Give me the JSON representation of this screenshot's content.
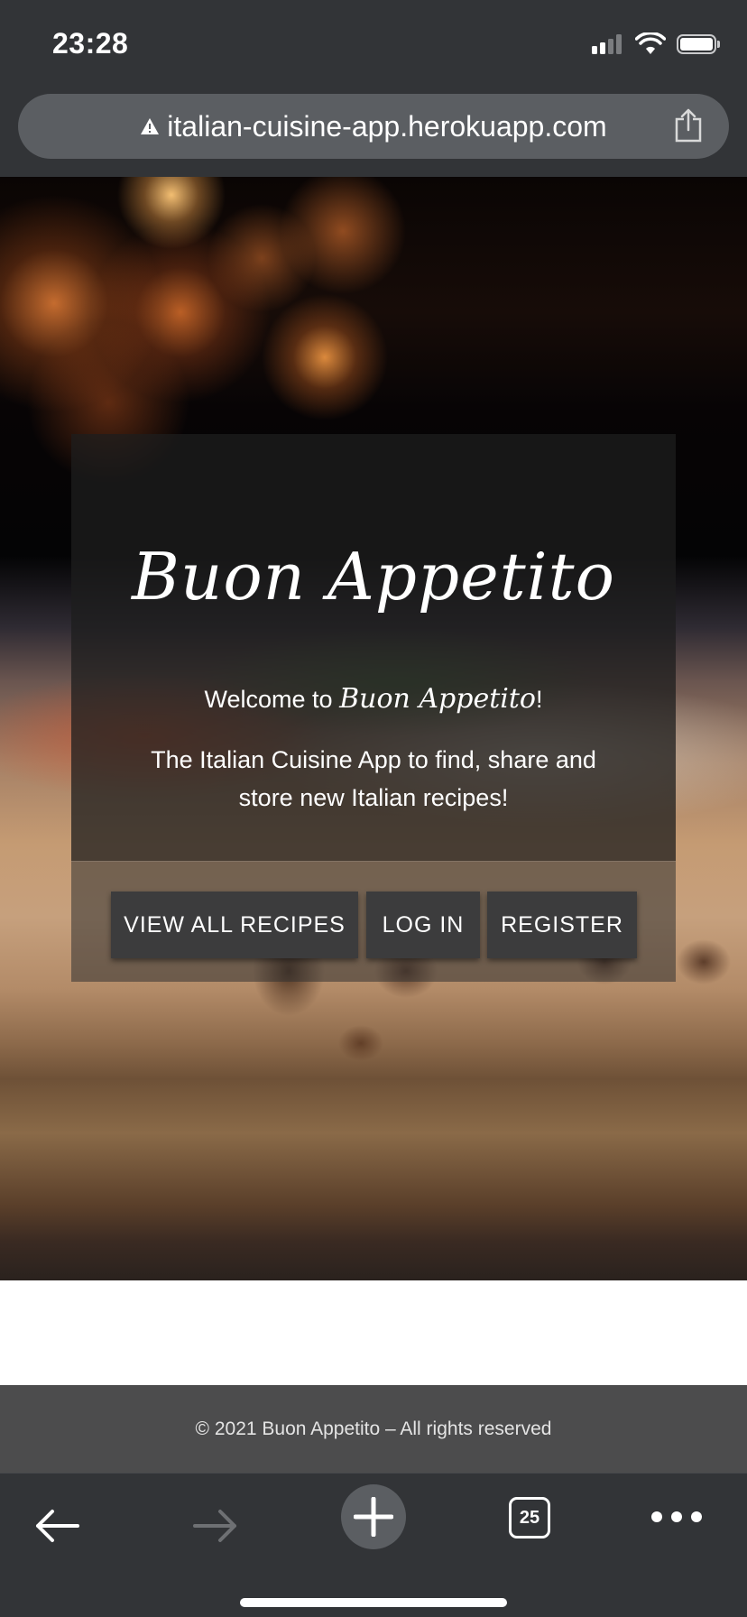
{
  "status_bar": {
    "time": "23:28",
    "icons": [
      "cellular-signal-icon",
      "wifi-icon",
      "battery-icon"
    ]
  },
  "browser": {
    "url": "italian-cuisine-app.herokuapp.com",
    "icons": [
      "warning-icon",
      "share-icon"
    ],
    "toolbar": {
      "tab_count": "25",
      "icons": [
        "back-arrow-icon",
        "forward-arrow-icon",
        "plus-icon",
        "tabs-icon",
        "more-dots-icon"
      ]
    }
  },
  "hero": {
    "title": "Buon Appetito",
    "welcome_prefix": "Welcome to ",
    "welcome_brand": "Buon Appetito",
    "welcome_suffix": "!",
    "description": "The Italian Cuisine App to find, share and store new Italian recipes!",
    "buttons": {
      "view_recipes": "VIEW ALL RECIPES",
      "login": "LOG IN",
      "register": "REGISTER"
    }
  },
  "footer": {
    "text": "© 2021 Buon Appetito – All rights reserved"
  },
  "colors": {
    "browser_chrome": "#323437",
    "address_bar": "#5b5e62",
    "card_overlay": "#1e1e1e",
    "button_bg": "#3c3c3d",
    "footer_bg": "#4c4c4d"
  }
}
